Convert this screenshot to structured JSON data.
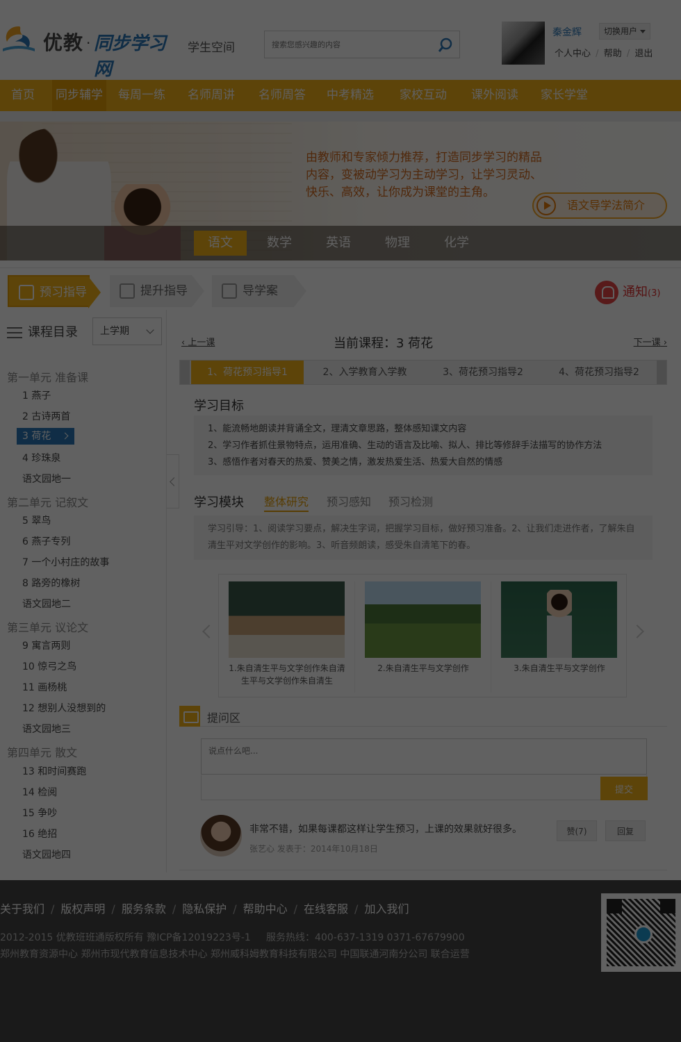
{
  "header": {
    "brand_youjiao": "优教",
    "brand_dot": "·",
    "brand_tongbu": "同步学习网",
    "student_space": "学生空间",
    "search_placeholder": "搜索您感兴趣的内容",
    "user_name": "秦金辉",
    "switch_user": "切换用户",
    "links": [
      "个人中心",
      "帮助",
      "退出"
    ],
    "link_sep": "/"
  },
  "nav": {
    "items": [
      "首页",
      "同步辅学",
      "每周一练",
      "名师周讲",
      "名师周答",
      "中考精选",
      "家校互动",
      "课外阅读",
      "家长学堂"
    ],
    "active_index": 1
  },
  "banner": {
    "description": "由教师和专家倾力推荐，打造同步学习的精品内容，变被动学习为主动学习，让学习灵动、快乐、高效，让你成为课堂的主角。",
    "method_button": "语文导学法简介",
    "subjects": [
      "语文",
      "数学",
      "英语",
      "物理",
      "化学"
    ],
    "active_subject": 0
  },
  "study_tabs": {
    "items": [
      "预习指导",
      "提升指导",
      "导学案"
    ],
    "active_index": 0
  },
  "notice": {
    "label": "通知",
    "count": "(3)"
  },
  "sidebar": {
    "title": "课程目录",
    "term": "上学期",
    "units": [
      {
        "name": "第一单元 准备课",
        "lessons": [
          "1 燕子",
          "2 古诗两首",
          "3 荷花",
          "4 珍珠泉",
          "语文园地一"
        ]
      },
      {
        "name": "第二单元 记叙文",
        "lessons": [
          "5 翠鸟",
          "6 燕子专列",
          "7 一个小村庄的故事",
          "8 路旁的橡树",
          "语文园地二"
        ]
      },
      {
        "name": "第三单元 议论文",
        "lessons": [
          "9 寓言两则",
          "10 惊弓之鸟",
          "11 画杨桃",
          "12 想别人没想到的",
          "语文园地三"
        ]
      },
      {
        "name": "第四单元 散文",
        "lessons": [
          "13 和时间赛跑",
          "14 检阅",
          "15 争吵",
          "16 绝招",
          "语文园地四"
        ]
      }
    ],
    "active_lesson": "3 荷花"
  },
  "content": {
    "prev": "上一课",
    "next": "下一课",
    "current_course": "当前课程：3 荷花",
    "course_tabs": [
      "1、荷花预习指导1",
      "2、入学教育入学教",
      "3、荷花预习指导2",
      "4、荷花预习指导2"
    ],
    "active_course_tab": 0,
    "goals_title": "学习目标",
    "goals": [
      "1、能流畅地朗读并背诵全文，理清文章思路，整体感知课文内容",
      "2、学习作者抓住景物特点，运用准确、生动的语言及比喻、拟人、排比等修辞手法描写的协作方法",
      "3、感悟作者对春天的热爱、赞美之情，激发热爱生活、热爱大自然的情感"
    ],
    "module_title": "学习模块",
    "module_tabs": [
      "整体研究",
      "预习感知",
      "预习检测"
    ],
    "active_module": 0,
    "guide": "学习引导：1、阅读学习要点，解决生字词，把握学习目标，做好预习准备。2、让我们走进作者，了解朱自清生平对文学创作的影响。3、听音频朗读，感受朱自清笔下的春。",
    "resources": [
      "1.朱自清生平与文学创作朱自清生平与文学创作朱自清生",
      "2.朱自清生平与文学创作",
      "3.朱自清生平与文学创作"
    ],
    "qa_title": "提问区",
    "qa_placeholder": "说点什么吧...",
    "submit": "提交",
    "comment": {
      "text": "非常不错，如果每课都这样让学生预习，上课的效果就好很多。",
      "meta": "张艺心 发表于：2014年10月18日",
      "like": "赞(7)",
      "reply": "回复"
    }
  },
  "footer": {
    "links": [
      "关于我们",
      "版权声明",
      "服务条款",
      "隐私保护",
      "帮助中心",
      "在线客服",
      "加入我们"
    ],
    "link_sep": "/",
    "copyright": "2012-2015 优教班班通版权所有 豫ICP备12019223号-1",
    "hotline": "服务热线：400-637-1319   0371-67679900",
    "operators": "郑州教育资源中心   郑州市现代教育信息技术中心   郑州威科姆教育科技有限公司 中国联通河南分公司  联合运营"
  },
  "colors": {
    "accent": "#f5b318",
    "accent_dark": "#e59f07",
    "blue": "#2a78b7",
    "footer_bg": "#444444"
  }
}
